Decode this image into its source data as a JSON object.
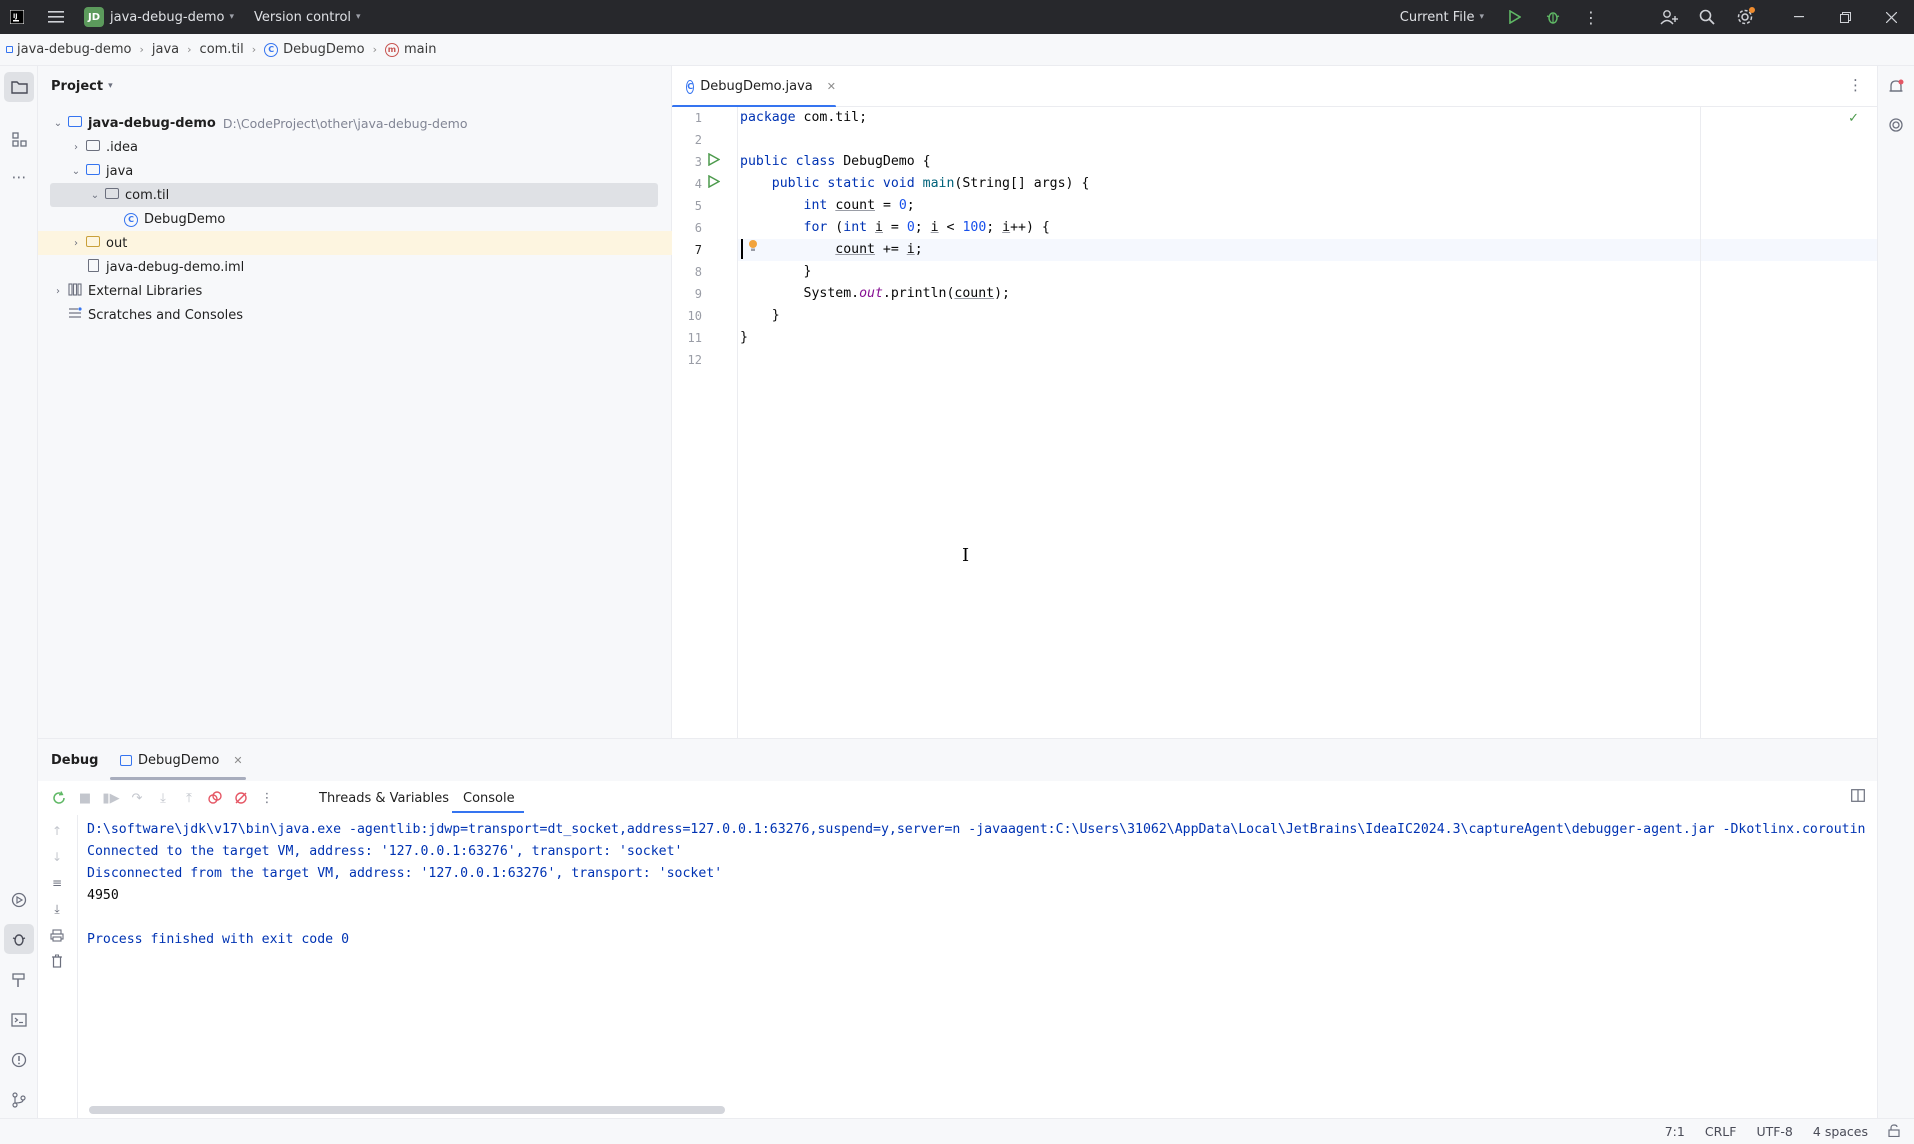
{
  "titlebar": {
    "project_badge": "JD",
    "project_name": "java-debug-demo",
    "version_control": "Version control",
    "run_config": "Current File"
  },
  "breadcrumb": [
    "java-debug-demo",
    "java",
    "com.til",
    "DebugDemo",
    "main"
  ],
  "project_panel": {
    "title": "Project",
    "root_name": "java-debug-demo",
    "root_path": "D:\\CodeProject\\other\\java-debug-demo",
    "items": [
      ".idea",
      "java",
      "com.til",
      "DebugDemo",
      "out",
      "java-debug-demo.iml",
      "External Libraries",
      "Scratches and Consoles"
    ]
  },
  "editor": {
    "tab_label": "DebugDemo.java",
    "line_numbers": [
      "1",
      "2",
      "3",
      "4",
      "5",
      "6",
      "7",
      "8",
      "9",
      "10",
      "11",
      "12"
    ]
  },
  "debug_panel": {
    "title": "Debug",
    "session_tab": "DebugDemo",
    "subtabs": [
      "Threads & Variables",
      "Console"
    ],
    "console_lines": [
      "D:\\software\\jdk\\v17\\bin\\java.exe -agentlib:jdwp=transport=dt_socket,address=127.0.0.1:63276,suspend=y,server=n -javaagent:C:\\Users\\31062\\AppData\\Local\\JetBrains\\IdeaIC2024.3\\captureAgent\\debugger-agent.jar -Dkotlinx.coroutin",
      "Connected to the target VM, address: '127.0.0.1:63276', transport: 'socket'",
      "Disconnected from the target VM, address: '127.0.0.1:63276', transport: 'socket'",
      "4950",
      "",
      "Process finished with exit code 0"
    ]
  },
  "statusbar": {
    "position": "7:1",
    "line_sep": "CRLF",
    "encoding": "UTF-8",
    "indent": "4 spaces"
  }
}
